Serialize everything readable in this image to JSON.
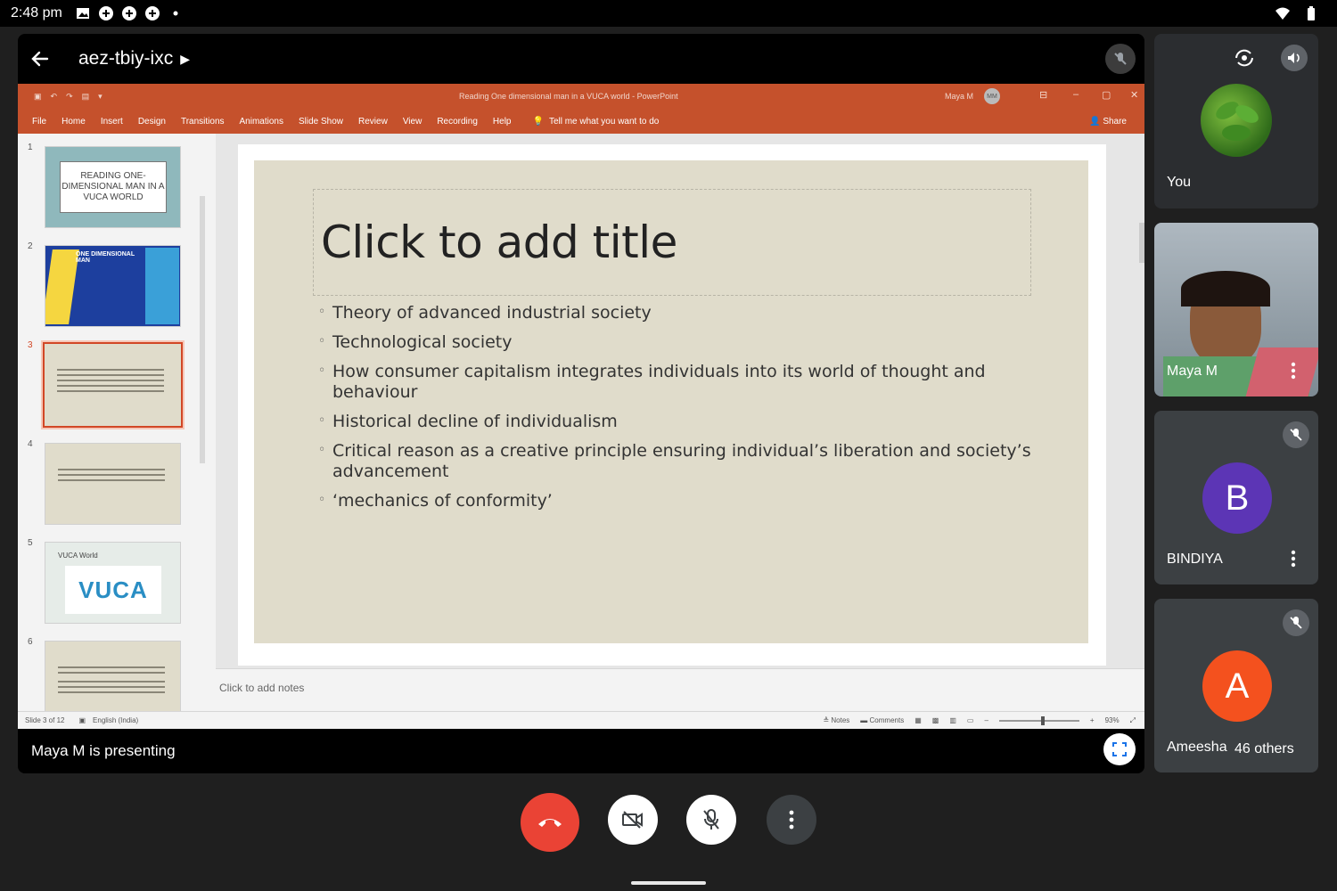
{
  "status_bar": {
    "time": "2:48 pm"
  },
  "meeting": {
    "code": "aez-tbiy-ixc",
    "presenting_text": "Maya M is presenting"
  },
  "ppt": {
    "window_title": "Reading One dimensional man in a VUCA world  -  PowerPoint",
    "user_name": "Maya M",
    "user_initials": "MM",
    "tabs": [
      "File",
      "Home",
      "Insert",
      "Design",
      "Transitions",
      "Animations",
      "Slide Show",
      "Review",
      "View",
      "Recording",
      "Help"
    ],
    "tell_me": "Tell me what you want to do",
    "share": "Share",
    "thumbnails": [
      {
        "num": "1",
        "text": "READING ONE-DIMENSIONAL MAN IN A VUCA WORLD"
      },
      {
        "num": "2",
        "text": "ONE DIMENSIONAL MAN"
      },
      {
        "num": "3",
        "text": ""
      },
      {
        "num": "4",
        "text": ""
      },
      {
        "num": "5",
        "text": "VUCA World"
      },
      {
        "num": "6",
        "text": ""
      }
    ],
    "thumb5_logo": "VUCA",
    "slide": {
      "title_placeholder": "Click to add title",
      "bullets": [
        "Theory of advanced industrial society",
        "Technological society",
        "How consumer capitalism integrates individuals into its world of thought and behaviour",
        "Historical decline of individualism",
        "Critical   reason as a creative principle ensuring individual’s liberation and society’s advancement",
        "‘mechanics of conformity’"
      ]
    },
    "notes_placeholder": "Click to add notes",
    "status": {
      "slide_info": "Slide 3 of 12",
      "language": "English (India)",
      "notes": "Notes",
      "comments": "Comments",
      "zoom": "93%",
      "zoom_fraction": 0.55
    }
  },
  "participants": [
    {
      "name": "You"
    },
    {
      "name": "Maya M"
    },
    {
      "name": "BINDIYA",
      "initial": "B",
      "color": "#5c35b5"
    },
    {
      "name": "Ameesha",
      "initial": "A",
      "color": "#f4511e",
      "others": "46 others"
    }
  ],
  "colors": {
    "end_call": "#ea4335",
    "ppt_ribbon": "#c5512c",
    "accent_selected": "#d24726"
  }
}
